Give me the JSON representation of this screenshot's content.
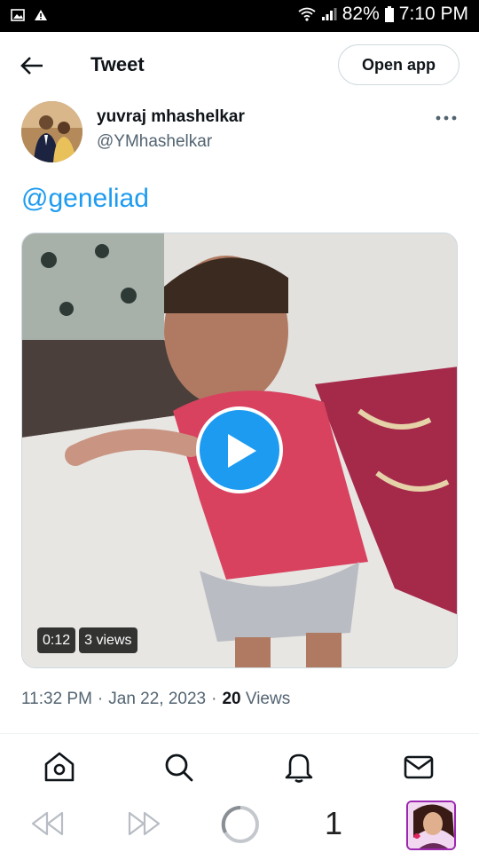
{
  "status_bar": {
    "battery": "82%",
    "time": "7:10 PM",
    "icons": [
      "image-icon",
      "warning-icon",
      "wifi-icon",
      "signal-icon",
      "battery-icon"
    ]
  },
  "header": {
    "title": "Tweet",
    "open_app_label": "Open app",
    "back_icon": "back-arrow-icon"
  },
  "tweet": {
    "author_name": "yuvraj mhashelkar",
    "author_handle": "@YMhashelkar",
    "text": "@geneliad",
    "more_icon": "more-dots-icon",
    "media": {
      "duration": "0:12",
      "views_badge": "3 views",
      "play_icon": "play-icon"
    },
    "time": "11:32 PM",
    "date": "Jan 22, 2023",
    "views_count": "20",
    "views_label": "Views",
    "separator": "·"
  },
  "bottom_nav": {
    "items": [
      "home-icon",
      "search-icon",
      "notifications-icon",
      "messages-icon"
    ]
  },
  "browser_bar": {
    "tab_count": "1",
    "icons": [
      "rewind-icon",
      "fast-forward-icon",
      "loading-spinner-icon"
    ]
  },
  "colors": {
    "accent": "#1d9bf0",
    "text": "#0f1419",
    "secondary": "#536471",
    "border": "#cfd9de"
  }
}
